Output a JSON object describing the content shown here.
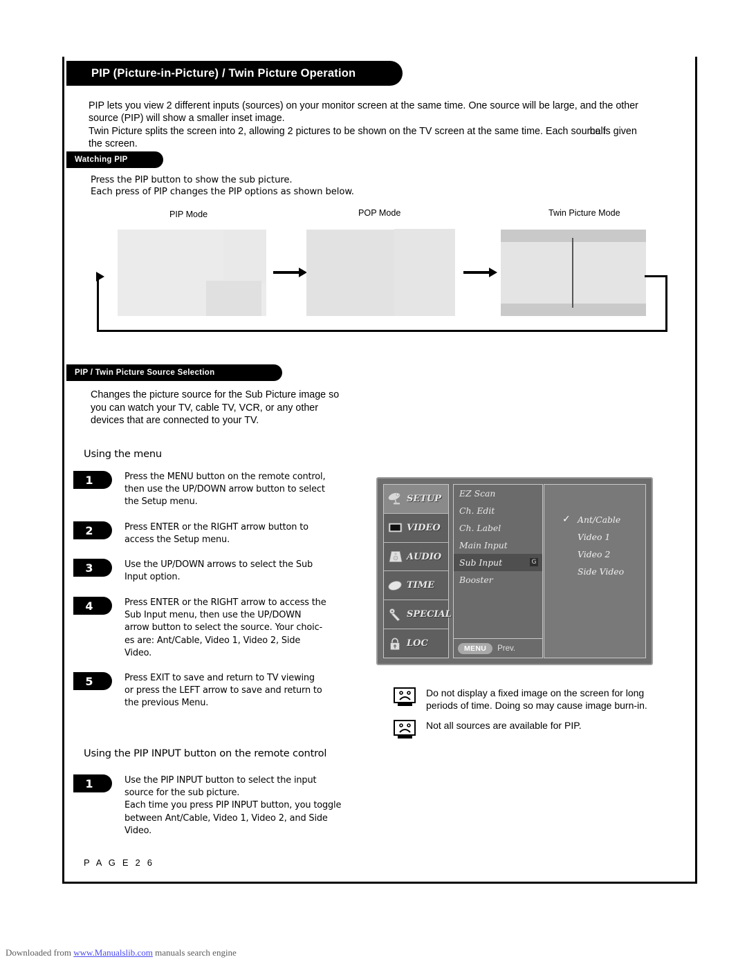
{
  "header": {
    "title": "PIP (Picture-in-Picture) / Twin Picture Operation"
  },
  "intro": {
    "line1": "PIP lets you view 2 different inputs (sources) on your monitor screen at the same time. One source will be large, and the other",
    "line2": "source (PIP) will show a smaller inset image.",
    "line3a": "Twin Picture splits the screen into 2, allowing 2 pictures to be shown on the TV screen at the same time. Each so",
    "line3b": "urce",
    "line3c": "half",
    "line3d": " is given",
    "line4": "the screen."
  },
  "watching": {
    "heading": "Watching PIP",
    "line1": "Press the PIP button to show the sub picture.",
    "line2": "Each press of PIP changes the PIP options as shown below."
  },
  "diagram": {
    "modes": [
      {
        "label": "PIP Mode"
      },
      {
        "label": "POP Mode"
      },
      {
        "label": "Twin Picture Mode"
      }
    ]
  },
  "source_selection": {
    "heading": "PIP / Twin Picture Source Selection",
    "line1": "Changes the picture source for the Sub Picture image so",
    "line2": "you can watch your TV, cable TV, VCR, or any other",
    "line3": "devices that are connected to your TV."
  },
  "using_menu": {
    "subhead": "Using the menu",
    "steps": [
      {
        "num": "1",
        "lines": [
          "Press the MENU button on the remote control,",
          "then use the UP/DOWN arrow button to select",
          "the Setup menu."
        ]
      },
      {
        "num": "2",
        "lines": [
          "Press ENTER or the RIGHT arrow button to",
          "access the Setup menu."
        ]
      },
      {
        "num": "3",
        "lines": [
          "Use the UP/DOWN arrows to select the Sub",
          "Input option."
        ]
      },
      {
        "num": "4",
        "lines": [
          "Press ENTER or the RIGHT arrow to access the",
          "Sub Input menu, then use the UP/DOWN",
          "arrow button to select the source. Your choic-",
          "es are: Ant/Cable, Video 1, Video 2, Side",
          "Video."
        ]
      },
      {
        "num": "5",
        "lines": [
          "Press EXIT to save and return to TV viewing",
          "or press the LEFT arrow to save and return to",
          "the previous Menu."
        ]
      }
    ]
  },
  "osd": {
    "sidebar": [
      {
        "label": "SETUP",
        "icon": "satellite-dish-icon",
        "active": true
      },
      {
        "label": "VIDEO",
        "icon": "tv-screen-icon",
        "active": false
      },
      {
        "label": "AUDIO",
        "icon": "speaker-icon",
        "active": false
      },
      {
        "label": "TIME",
        "icon": "clock-disc-icon",
        "active": false
      },
      {
        "label": "SPECIAL",
        "icon": "key-icon",
        "active": false
      },
      {
        "label": "LOC",
        "icon": "padlock-icon",
        "active": false
      }
    ],
    "menu_items": [
      {
        "label": "EZ Scan",
        "selected": false
      },
      {
        "label": "Ch. Edit",
        "selected": false
      },
      {
        "label": "Ch. Label",
        "selected": false
      },
      {
        "label": "Main Input",
        "selected": false
      },
      {
        "label": "Sub Input",
        "selected": true,
        "cursor": "G"
      },
      {
        "label": "Booster",
        "selected": false
      }
    ],
    "options": [
      {
        "label": "Ant/Cable",
        "checked": true
      },
      {
        "label": "Video 1",
        "checked": false
      },
      {
        "label": "Video 2",
        "checked": false
      },
      {
        "label": "Side Video",
        "checked": false
      }
    ],
    "footer": {
      "menu_key": "MENU",
      "prev_label": "Prev."
    }
  },
  "notes": [
    {
      "icon": "sad-tv-icon",
      "line1": "Do not display a fixed image on the screen for long",
      "line2": "periods of  time. Doing so may cause image burn-in."
    },
    {
      "icon": "sad-tv-icon",
      "line1": "Not all sources are available for PIP.",
      "line2": ""
    }
  ],
  "using_remote": {
    "subhead": "Using the PIP INPUT button on the remote control",
    "steps": [
      {
        "num": "1",
        "lines": [
          "Use the PIP INPUT button to select the input",
          "source for the sub picture.",
          "Each time you press PIP INPUT button, you toggle",
          "between Ant/Cable, Video 1, Video 2, and Side",
          "Video."
        ]
      }
    ]
  },
  "footer": {
    "page_label": "P A G E   2 6",
    "download_prefix": "Downloaded from ",
    "download_link": "www.Manualslib.com",
    "download_suffix": "  manuals search engine"
  },
  "colors": {
    "ink": "#000000",
    "osd_bg": "#6d6d6d",
    "osd_selected": "#4f4f4f",
    "link": "#4a4af0"
  }
}
